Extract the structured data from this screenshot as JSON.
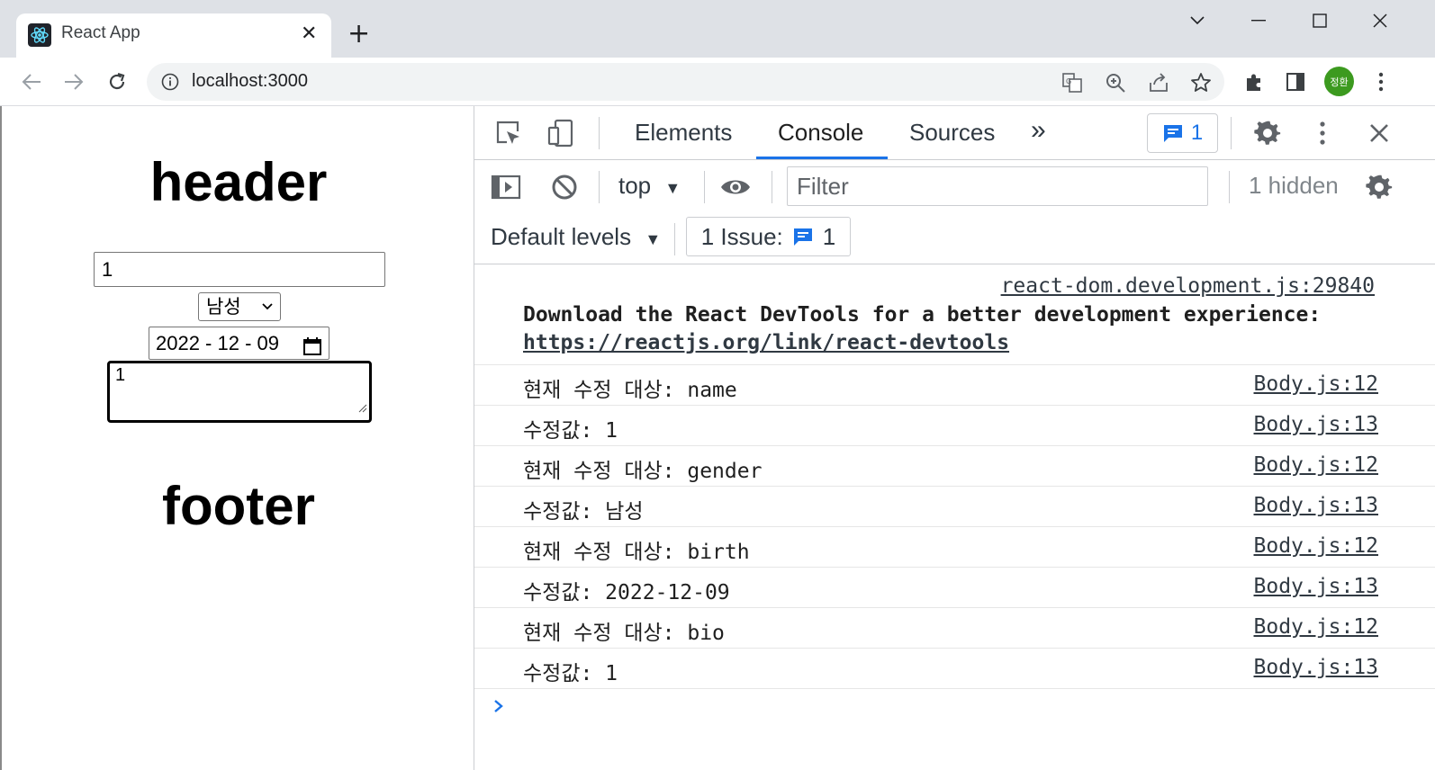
{
  "browser": {
    "tab_title": "React App",
    "url": "localhost:3000",
    "avatar_text": "정환"
  },
  "page": {
    "header": "header",
    "name_value": "1",
    "gender_value": "남성",
    "birth_value": "2022 - 12 - 09",
    "bio_value": "1",
    "footer": "footer"
  },
  "devtools": {
    "tabs": [
      "Elements",
      "Console",
      "Sources"
    ],
    "active_tab": "Console",
    "issue_badge_count": "1",
    "context": "top",
    "filter_placeholder": "Filter",
    "hidden_count": "1 hidden",
    "levels": "Default levels",
    "issues_label": "1 Issue:",
    "issues_count": "1",
    "accent_color": "#1a73e8"
  },
  "console": {
    "intro_source": "react-dom.development.js:29840",
    "intro_text": "Download the React DevTools for a better development experience:",
    "intro_link": "https://reactjs.org/link/react-devtools",
    "rows": [
      {
        "text": "현재 수정 대상: name",
        "source": "Body.js:12"
      },
      {
        "text": "수정값: 1",
        "source": "Body.js:13"
      },
      {
        "text": "현재 수정 대상: gender",
        "source": "Body.js:12"
      },
      {
        "text": "수정값: 남성",
        "source": "Body.js:13"
      },
      {
        "text": "현재 수정 대상: birth",
        "source": "Body.js:12"
      },
      {
        "text": "수정값: 2022-12-09",
        "source": "Body.js:13"
      },
      {
        "text": "현재 수정 대상: bio",
        "source": "Body.js:12"
      },
      {
        "text": "수정값: 1",
        "source": "Body.js:13"
      }
    ]
  }
}
